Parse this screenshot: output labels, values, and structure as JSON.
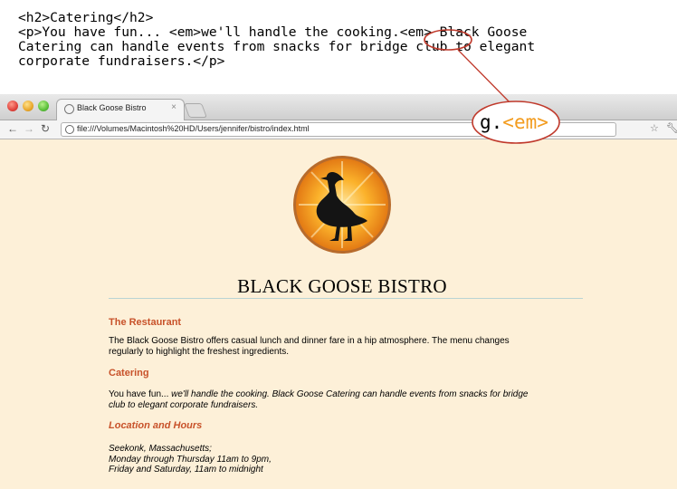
{
  "code": {
    "lines": [
      "<h2>Catering</h2>",
      "<p>You have fun... <em>we'll handle the cooking.<em> Black Goose",
      "Catering can handle events from snacks for bridge club to elegant",
      "corporate fundraisers.</p>"
    ]
  },
  "browser": {
    "tab_title": "Black Goose Bistro",
    "tab_close": "×",
    "url": "file:///Volumes/Macintosh%20HD/Users/jennifer/bistro/index.html"
  },
  "page": {
    "title": "BLACK GOOSE BISTRO",
    "sections": [
      {
        "heading": "The Restaurant",
        "body": [
          "The Black Goose Bistro offers casual lunch and dinner fare in a hip atmosphere. The menu changes",
          "regularly to highlight the freshest ingredients."
        ]
      },
      {
        "heading": "Catering",
        "body_plain": "You have fun... ",
        "body_em_1": "we'll handle the cooking. Black Goose Catering can handle events from snacks for bridge",
        "body_em_2": "club to elegant corporate fundraisers."
      },
      {
        "heading": "Location and Hours",
        "body": [
          "Seekonk, Massachusetts;",
          "Monday through Thursday 11am to 9pm,",
          "Friday and Saturday, 11am to midnight"
        ]
      }
    ]
  },
  "callout": {
    "text_plain": "g.",
    "text_tag": "<em>",
    "circle_color": "#c0392b"
  }
}
